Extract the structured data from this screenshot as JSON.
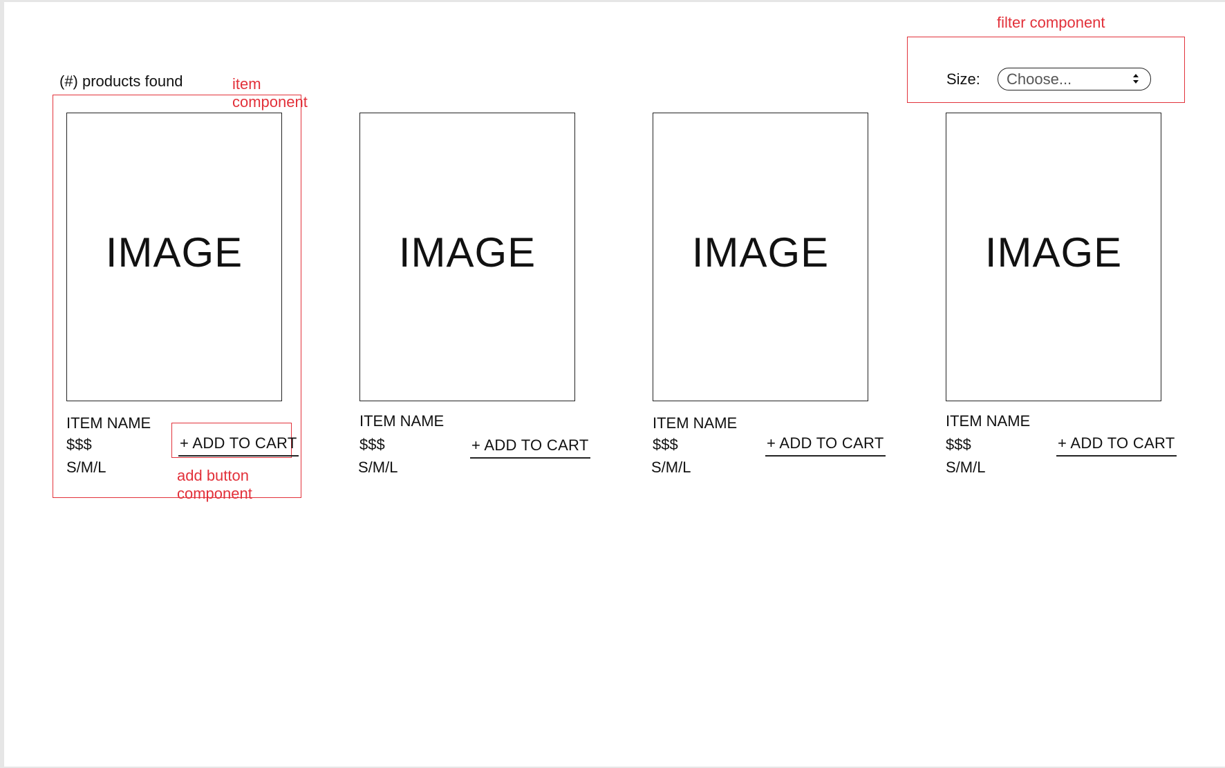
{
  "header": {
    "results_text": "(#) products found"
  },
  "filter": {
    "label": "Size:",
    "placeholder": "Choose..."
  },
  "annotations": {
    "item_line1": "item",
    "item_line2": "component",
    "button_line1": "add button",
    "button_line2": "component",
    "filter": "filter component"
  },
  "products": [
    {
      "image_label": "IMAGE",
      "name": "ITEM NAME",
      "price": "$$$",
      "sizes": "S/M/L",
      "button": "+ ADD TO CART"
    },
    {
      "image_label": "IMAGE",
      "name": "ITEM NAME",
      "price": "$$$",
      "sizes": "S/M/L",
      "button": "+ ADD TO CART"
    },
    {
      "image_label": "IMAGE",
      "name": "ITEM NAME",
      "price": "$$$",
      "sizes": "S/M/L",
      "button": "+ ADD TO CART"
    },
    {
      "image_label": "IMAGE",
      "name": "ITEM NAME",
      "price": "$$$",
      "sizes": "S/M/L",
      "button": "+ ADD TO CART"
    }
  ],
  "colors": {
    "annotation": "#e2313a",
    "outline": "#222222",
    "background": "#ffffff"
  }
}
